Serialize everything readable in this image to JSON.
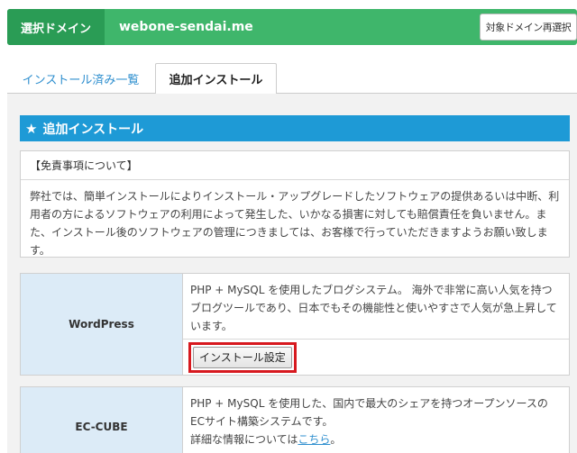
{
  "domain_bar": {
    "label": "選択ドメイン",
    "domain": "webone-sendai.me",
    "reselect_button": "対象ドメイン再選択"
  },
  "tabs": [
    {
      "label": "インストール済み一覧",
      "active": false
    },
    {
      "label": "追加インストール",
      "active": true
    }
  ],
  "section": {
    "icon": "star-icon",
    "title": "追加インストール"
  },
  "disclaimer": {
    "title": "【免責事項について】",
    "body": "弊社では、簡単インストールによりインストール・アップグレードしたソフトウェアの提供あるいは中断、利用者の方によるソフトウェアの利用によって発生した、いかなる損害に対しても賠償責任を負いません。また、インストール後のソフトウェアの管理につきましては、お客様で行っていただきますようお願い致します。"
  },
  "apps": [
    {
      "name": "WordPress",
      "description": "PHP + MySQL を使用したブログシステム。 海外で非常に高い人気を持つブログツールであり、日本でもその機能性と使いやすさで人気が急上昇しています。",
      "install_button": "インストール設定"
    },
    {
      "name": "EC-CUBE",
      "description": "PHP + MySQL を使用した、国内で最大のシェアを持つオープンソースのECサイト構築システムです。",
      "detail_prefix": "詳細な情報については",
      "detail_link": "こちら",
      "detail_suffix": "。"
    }
  ],
  "colors": {
    "domain_bar": "#3fb66b",
    "section_head": "#1e9ad6",
    "app_name_bg": "#dcebf7",
    "highlight": "#d7191f",
    "link": "#2f8fcf"
  }
}
